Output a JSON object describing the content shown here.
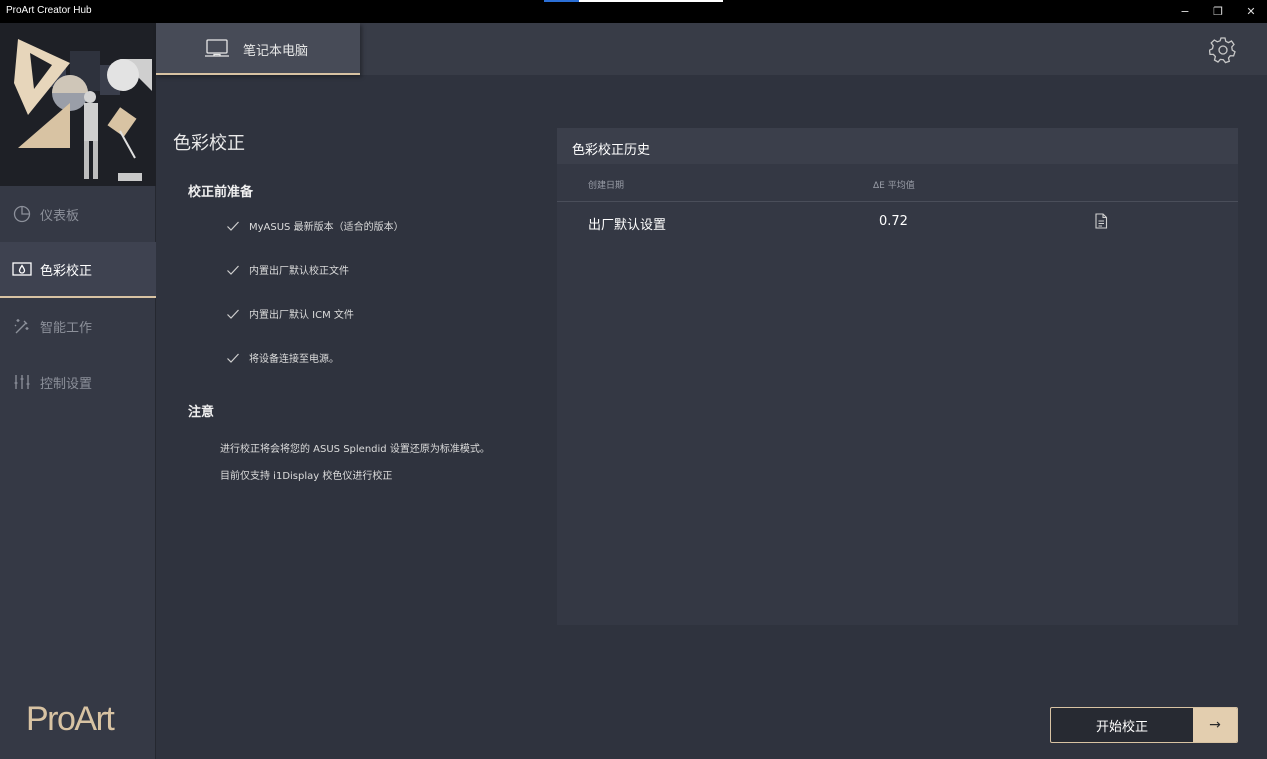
{
  "window": {
    "title": "ProArt Creator Hub",
    "minimize": "−",
    "maximize": "❐",
    "close": "✕"
  },
  "sidebar": {
    "items": [
      {
        "label": "仪表板",
        "icon": "pie-chart-icon",
        "active": false
      },
      {
        "label": "色彩校正",
        "icon": "color-calibration-icon",
        "active": true
      },
      {
        "label": "智能工作",
        "icon": "magic-wand-icon",
        "active": false
      },
      {
        "label": "控制设置",
        "icon": "sliders-icon",
        "active": false
      }
    ],
    "brand": "ProArt"
  },
  "topbar": {
    "device_tab": "笔记本电脑",
    "device_icon": "laptop-icon",
    "settings_icon": "gear-icon"
  },
  "main": {
    "title": "色彩校正",
    "prep_title": "校正前准备",
    "prep_items": [
      "MyASUS 最新版本（适合的版本）",
      "内置出厂默认校正文件",
      "内置出厂默认 ICM 文件",
      "将设备连接至电源。"
    ],
    "note_title": "注意",
    "notes": [
      "进行校正将会将您的 ASUS Splendid 设置还原为标准模式。",
      "目前仅支持 i1Display 校色仪进行校正"
    ]
  },
  "history": {
    "title": "色彩校正历史",
    "columns": [
      "创建日期",
      "ΔE 平均值"
    ],
    "rows": [
      {
        "date": "出厂默认设置",
        "delta_e": "0.72",
        "icon": "document-icon"
      }
    ]
  },
  "actions": {
    "start_label": "开始校正",
    "start_arrow": "→"
  },
  "colors": {
    "accent": "#d8c3a3",
    "background": "#2f333e",
    "sidebar": "#353945",
    "panel": "#343844"
  }
}
